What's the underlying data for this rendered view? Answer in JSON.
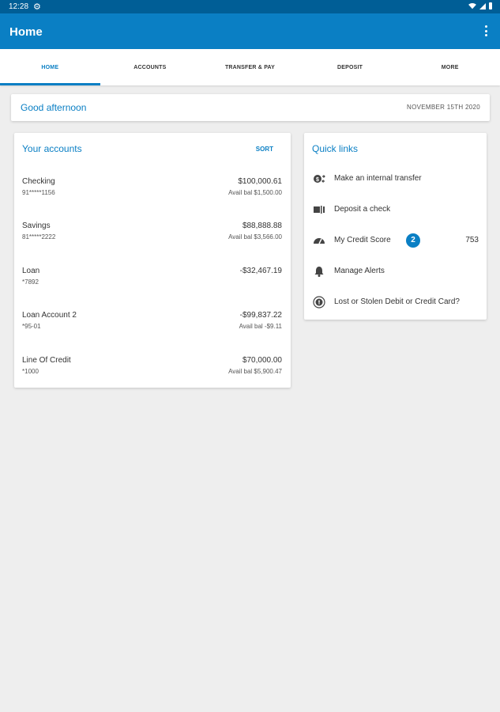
{
  "status_bar": {
    "time": "12:28",
    "icons": [
      "gear-icon",
      "wifi-icon",
      "signal-icon",
      "battery-icon"
    ]
  },
  "app_bar": {
    "title": "Home",
    "menu_icon": "more-vert-icon"
  },
  "tabs": [
    {
      "label": "HOME",
      "active": true
    },
    {
      "label": "ACCOUNTS",
      "active": false
    },
    {
      "label": "TRANSFER & PAY",
      "active": false
    },
    {
      "label": "DEPOSIT",
      "active": false
    },
    {
      "label": "MORE",
      "active": false
    }
  ],
  "greeting": {
    "text": "Good afternoon",
    "date": "NOVEMBER 15TH 2020"
  },
  "accounts": {
    "title": "Your accounts",
    "sort_label": "SORT",
    "items": [
      {
        "name": "Checking",
        "number": "91*****1156",
        "balance": "$100,000.61",
        "avail": "Avail bal $1,500.00"
      },
      {
        "name": "Savings",
        "number": "81*****2222",
        "balance": "$88,888.88",
        "avail": "Avail bal $3,566.00"
      },
      {
        "name": "Loan",
        "number": "*7892",
        "balance": "-$32,467.19",
        "avail": ""
      },
      {
        "name": "Loan Account 2",
        "number": "*95-01",
        "balance": "-$99,837.22",
        "avail": "Avail bal -$9.11"
      },
      {
        "name": "Line Of Credit",
        "number": "*1000",
        "balance": "$70,000.00",
        "avail": "Avail bal $5,900.47"
      }
    ]
  },
  "quick_links": {
    "title": "Quick links",
    "items": [
      {
        "label": "Make an internal transfer",
        "icon": "transfer-icon"
      },
      {
        "label": "Deposit a check",
        "icon": "check-deposit-icon"
      },
      {
        "label": "My Credit Score",
        "icon": "speedometer-icon",
        "badge": "2",
        "value": "753"
      },
      {
        "label": "Manage Alerts",
        "icon": "bell-icon"
      },
      {
        "label": "Lost or Stolen Debit or Credit Card?",
        "icon": "info-icon"
      }
    ]
  },
  "colors": {
    "primary": "#0a7fc4",
    "status_bar": "#005e96",
    "background": "#eeeeee"
  }
}
